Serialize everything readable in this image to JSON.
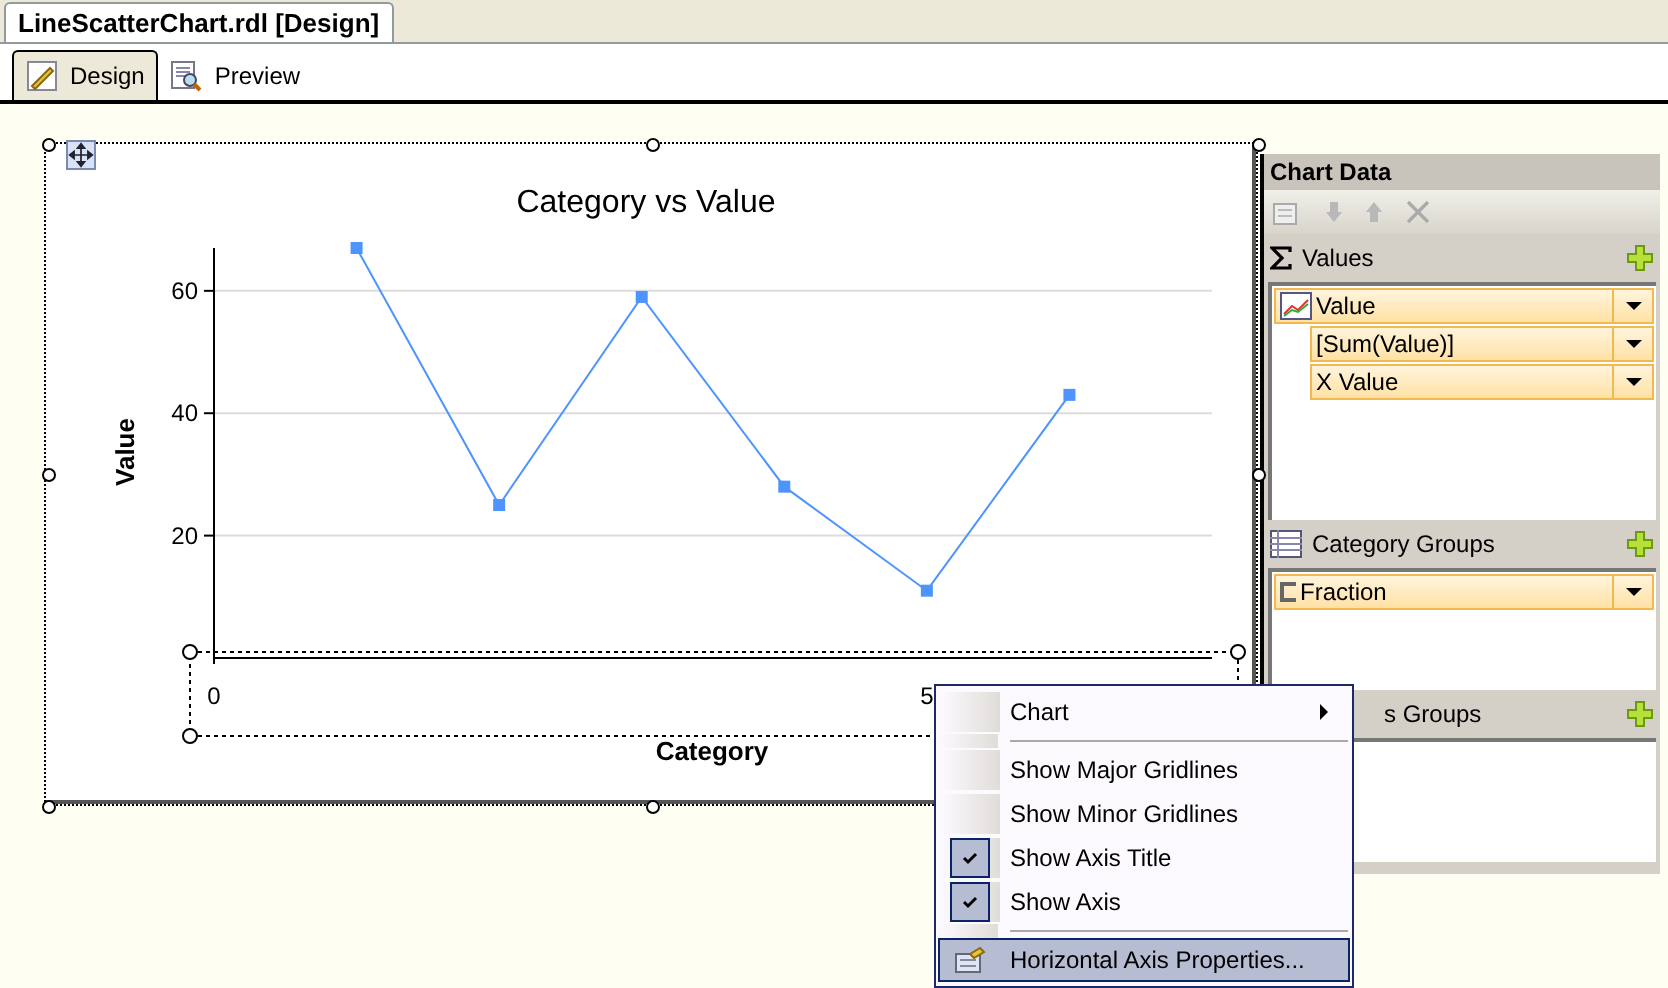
{
  "document_tab": {
    "title": "LineScatterChart.rdl [Design]"
  },
  "view_tabs": [
    {
      "label": "Design",
      "kind": "design",
      "selected": true
    },
    {
      "label": "Preview",
      "kind": "preview",
      "selected": false
    }
  ],
  "chart": {
    "chart_data": {
      "type": "line",
      "title": "Category vs Value",
      "xlabel": "Category",
      "ylabel": "Value",
      "x": [
        1,
        2,
        3,
        4,
        5,
        6
      ],
      "series": [
        {
          "color": "#4d94ff",
          "marker": "square",
          "values": [
            67,
            25,
            59,
            28,
            11,
            43
          ]
        }
      ],
      "grid": true,
      "xlim": [
        0,
        7
      ],
      "ylim": [
        0,
        67
      ],
      "xticks": [
        0,
        5
      ],
      "yticks": [
        20,
        40,
        60
      ]
    }
  },
  "chart_data_panel": {
    "title": "Chart Data",
    "sections": [
      {
        "label": "Values",
        "kind": "values",
        "items": [
          {
            "label": "Value",
            "kind": "series",
            "children": [
              {
                "label": "[Sum(Value)]"
              },
              {
                "label": "X Value"
              }
            ]
          }
        ]
      },
      {
        "label": "Category Groups",
        "kind": "category",
        "items": [
          {
            "label": "Fraction",
            "kind": "group"
          }
        ]
      },
      {
        "label": "s Groups",
        "kind": "series_groups"
      }
    ]
  },
  "context_menu": [
    {
      "label": "Chart",
      "kind": "submenu",
      "checked": false,
      "selected": false
    },
    {
      "kind": "separator"
    },
    {
      "label": "Show Major Gridlines",
      "kind": "item",
      "checked": false,
      "selected": false
    },
    {
      "label": "Show Minor Gridlines",
      "kind": "item",
      "checked": false,
      "selected": false
    },
    {
      "label": "Show Axis Title",
      "kind": "item",
      "checked": true,
      "selected": false
    },
    {
      "label": "Show Axis",
      "kind": "item",
      "checked": true,
      "selected": false
    },
    {
      "kind": "separator"
    },
    {
      "label": "Horizontal Axis Properties...",
      "kind": "properties",
      "checked": false,
      "selected": true
    }
  ]
}
